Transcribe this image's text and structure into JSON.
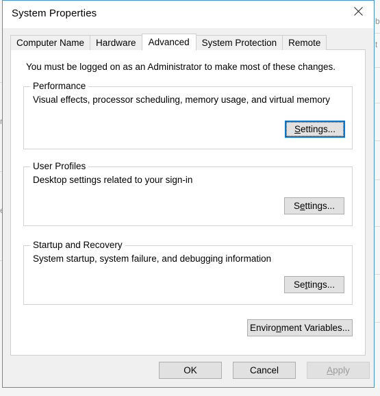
{
  "window": {
    "title": "System Properties",
    "close_icon": "close-icon"
  },
  "tabs": [
    {
      "label": "Computer Name",
      "selected": false
    },
    {
      "label": "Hardware",
      "selected": false
    },
    {
      "label": "Advanced",
      "selected": true
    },
    {
      "label": "System Protection",
      "selected": false
    },
    {
      "label": "Remote",
      "selected": false
    }
  ],
  "content": {
    "admin_note": "You must be logged on as an Administrator to make most of these changes.",
    "groups": [
      {
        "legend": "Performance",
        "description": "Visual effects, processor scheduling, memory usage, and virtual memory",
        "button": {
          "label": "Settings...",
          "accesskey_before": "S",
          "accesskey": "",
          "accesskey_after": "ettings...",
          "focused": true
        }
      },
      {
        "legend": "User Profiles",
        "description": "Desktop settings related to your sign-in",
        "button": {
          "label": "Settings...",
          "accesskey_before": "S",
          "accesskey": "e",
          "accesskey_after": "ttings...",
          "focused": false
        }
      },
      {
        "legend": "Startup and Recovery",
        "description": "System startup, system failure, and debugging information",
        "button": {
          "label": "Settings...",
          "accesskey_before": "Se",
          "accesskey": "t",
          "accesskey_after": "tings...",
          "focused": false
        }
      }
    ],
    "env_button": {
      "label": "Environment Variables...",
      "accesskey_before": "Enviro",
      "accesskey": "n",
      "accesskey_after": "ment Variables..."
    }
  },
  "footer": {
    "ok": {
      "label": "OK",
      "disabled": false
    },
    "cancel": {
      "label": "Cancel",
      "disabled": false
    },
    "apply": {
      "label": "Apply",
      "accesskey_before": "",
      "accesskey": "A",
      "accesskey_after": "pply",
      "disabled": true
    }
  },
  "background": {
    "glyph_right_1": "b",
    "glyph_right_2": "t",
    "glyph_left_1": "r",
    "glyph_left_2": "e"
  },
  "colors": {
    "window_border": "#4a93c4",
    "dialog_face": "#f0f0f0",
    "panel": "#ffffff",
    "button_face": "#e1e1e1",
    "button_border": "#adadad",
    "focus_accent": "#0078d7",
    "disabled_text": "#9b9b9b",
    "group_border": "#d3d3d3"
  }
}
